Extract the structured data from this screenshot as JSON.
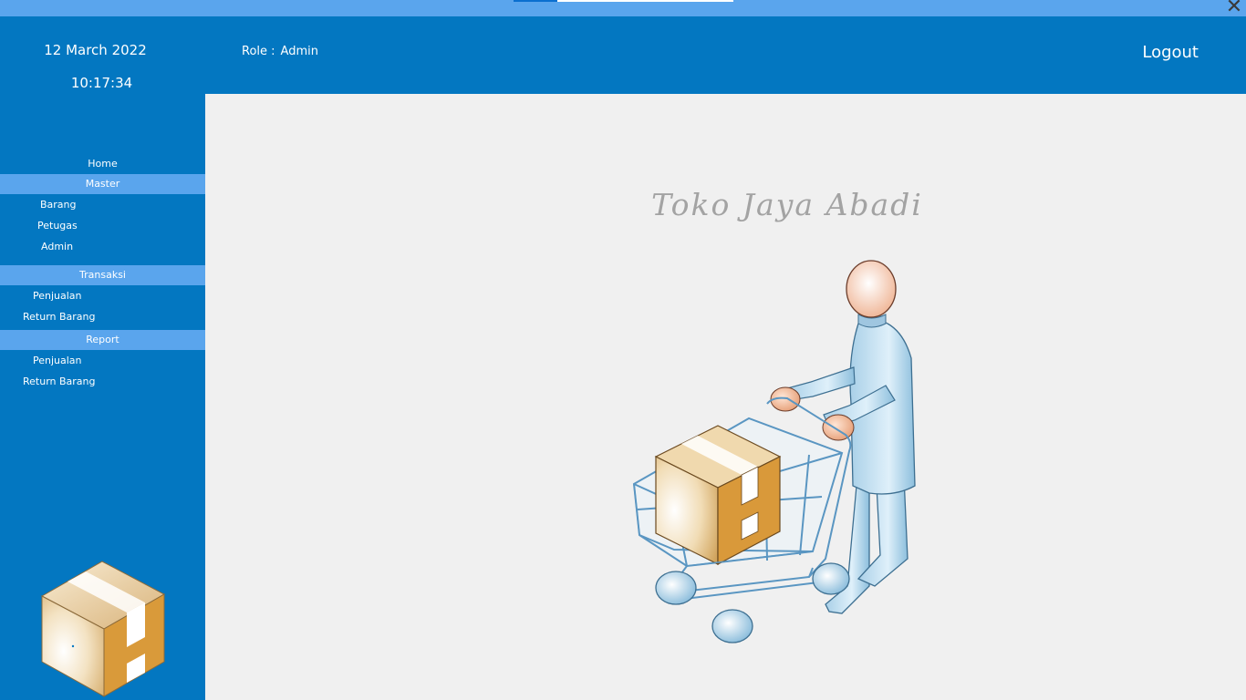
{
  "window": {
    "close_glyph": "✕"
  },
  "sidebar": {
    "date": "12 March 2022",
    "time": "10:17:34",
    "home_label": "Home",
    "master": {
      "label": "Master",
      "items": [
        "Barang",
        "Petugas",
        "Admin"
      ]
    },
    "transaksi": {
      "label": "Transaksi",
      "items": [
        "Penjualan",
        "Return Barang"
      ]
    },
    "report": {
      "label": "Report",
      "items": [
        "Penjualan",
        "Return Barang"
      ]
    }
  },
  "header": {
    "role_label": "Role :",
    "role_value": "Admin",
    "logout_label": "Logout"
  },
  "main": {
    "store_name": "Toko Jaya Abadi",
    "illustration": "shopping-cart-person-icon"
  },
  "colors": {
    "primary": "#0377c1",
    "section_highlight": "#5aa5ed",
    "content_bg": "#f0f0f0",
    "title_text": "#a3a3a3",
    "box_orange": "#d99a3a"
  }
}
